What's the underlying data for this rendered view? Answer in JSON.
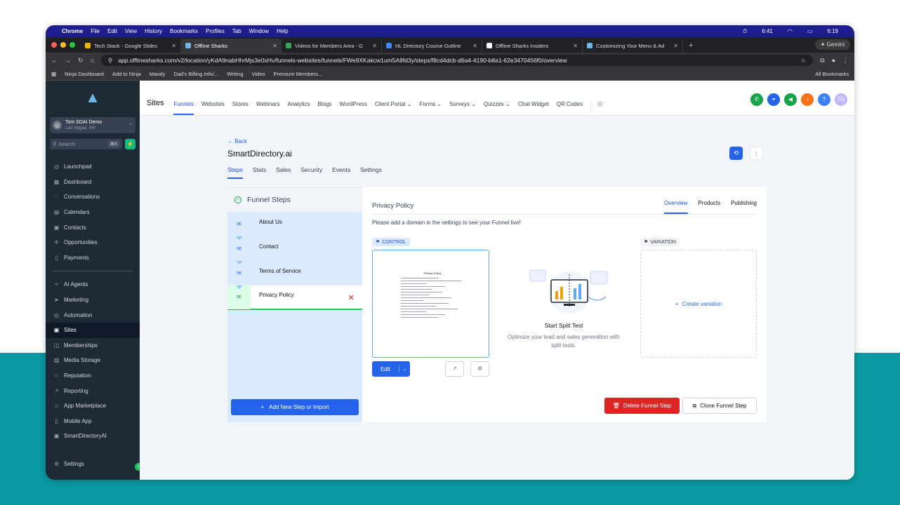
{
  "menubar": {
    "app": "Chrome",
    "items": [
      "File",
      "Edit",
      "View",
      "History",
      "Bookmarks",
      "Profiles",
      "Tab",
      "Window",
      "Help"
    ],
    "clock1": "6:41",
    "clock2": "6:19"
  },
  "tabs": [
    {
      "title": "Tech Stack - Google Slides",
      "color": "#f4b400"
    },
    {
      "title": "Offline Sharks",
      "color": "#6fb5e8"
    },
    {
      "title": "Videos for Members Area - G",
      "color": "#34a853"
    },
    {
      "title": "HL Directory Course Outline",
      "color": "#4285f4"
    },
    {
      "title": "Offline Sharks Insiders",
      "color": "#ffffff"
    },
    {
      "title": "Customizing Your Menu & Ad",
      "color": "#6fb5e8"
    }
  ],
  "gemini": "Gemini",
  "url": "app.offlinesharks.com/v2/location/yKdA9nabHhrMjs3e0xHv/funnels-websites/funnels/FWe9XKakcw1um5A9fd3y/steps/f8cd4dcb-d6a4-4190-b8a1-62e3470456f0/overview",
  "bookmarks": [
    "Ninja Dashboard",
    "Add to Ninja",
    "Mandy",
    "Dad's Billing Info/...",
    "Writing",
    "Video",
    "Premium Members..."
  ],
  "all_bookmarks": "All Bookmarks",
  "sidebar": {
    "account_name": "Tom SDAI Demo",
    "account_loc": "Las Vegas, NV",
    "search_placeholder": "Search",
    "search_kbd": "⌘K",
    "group1": [
      {
        "label": "Launchpad",
        "icon": "launchpad-icon"
      },
      {
        "label": "Dashboard",
        "icon": "dashboard-icon"
      },
      {
        "label": "Conversations",
        "icon": "conversations-icon"
      },
      {
        "label": "Calendars",
        "icon": "calendar-icon"
      },
      {
        "label": "Contacts",
        "icon": "contacts-icon"
      },
      {
        "label": "Opportunities",
        "icon": "opportunities-icon"
      },
      {
        "label": "Payments",
        "icon": "payments-icon"
      }
    ],
    "group2": [
      {
        "label": "AI Agents",
        "icon": "ai-agents-icon"
      },
      {
        "label": "Marketing",
        "icon": "marketing-icon"
      },
      {
        "label": "Automation",
        "icon": "automation-icon"
      },
      {
        "label": "Sites",
        "icon": "sites-icon"
      },
      {
        "label": "Memberships",
        "icon": "memberships-icon"
      },
      {
        "label": "Media Storage",
        "icon": "media-icon"
      },
      {
        "label": "Reputation",
        "icon": "reputation-icon"
      },
      {
        "label": "Reporting",
        "icon": "reporting-icon"
      },
      {
        "label": "App Marketplace",
        "icon": "marketplace-icon"
      },
      {
        "label": "Mobile App",
        "icon": "mobile-icon"
      },
      {
        "label": "SmartDirectoryAI",
        "icon": "smartdirectory-icon"
      }
    ],
    "active": "Sites",
    "settings": "Settings"
  },
  "topnav": {
    "title": "Sites",
    "items": [
      "Funnels",
      "Websites",
      "Stores",
      "Webinars",
      "Analytics",
      "Blogs",
      "WordPress",
      "Client Portal",
      "Forms",
      "Surveys",
      "Quizzes",
      "Chat Widget",
      "QR Codes"
    ],
    "dropdowns": [
      "Client Portal",
      "Forms",
      "Surveys",
      "Quizzes"
    ],
    "active": "Funnels",
    "avatar": "TG"
  },
  "funnel": {
    "back": "← Back",
    "name": "SmartDirectory.ai",
    "tabs": [
      "Steps",
      "Stats",
      "Sales",
      "Security",
      "Events",
      "Settings"
    ],
    "active_tab": "Steps"
  },
  "steps_panel": {
    "header": "Funnel Steps",
    "steps": [
      "About Us",
      "Contact",
      "Terms of Service",
      "Privacy Policy"
    ],
    "active": "Privacy Policy",
    "add_button": "Add New Step or Import"
  },
  "step_detail": {
    "title": "Privacy Policy",
    "tabs": [
      "Overview",
      "Products",
      "Publishing"
    ],
    "active_tab": "Overview",
    "message": "Please add a domain in the settings to see your Funnel live!",
    "control_label": "CONTROL",
    "variation_label": "VARIATION",
    "thumb_title": "Privacy Policy",
    "edit": "Edit",
    "split_title": "Start Split Test",
    "split_sub": "Optimize your lead and sales generation with split tests.",
    "create_variation": "Create variation",
    "delete_button": "Delete Funnel Step",
    "clone_button": "Clone Funnel Step"
  },
  "colors": {
    "accent": "#2563eb",
    "danger": "#dc2626",
    "sidebar": "#1f2a37",
    "success": "#22c55e"
  }
}
